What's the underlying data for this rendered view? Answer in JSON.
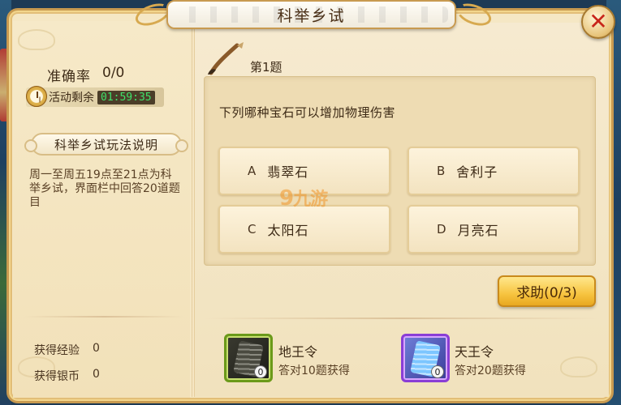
{
  "dialog": {
    "title": "科举乡试",
    "close_label": "✕"
  },
  "left_panel": {
    "accuracy_label": "准确率",
    "accuracy_value": "0/0",
    "timer_label": "活动剩余",
    "timer_value": "01:59:35",
    "rules_title": "科举乡试玩法说明",
    "rules_text": "周一至周五19点至21点为科举乡试，界面栏中回答20道题目",
    "stats": [
      {
        "label": "获得经验",
        "value": "0"
      },
      {
        "label": "获得银币",
        "value": "0"
      }
    ]
  },
  "question": {
    "number_label": "第1题",
    "text": "下列哪种宝石可以增加物理伤害",
    "options": [
      {
        "letter": "A",
        "text": "翡翠石"
      },
      {
        "letter": "B",
        "text": "舍利子"
      },
      {
        "letter": "C",
        "text": "太阳石"
      },
      {
        "letter": "D",
        "text": "月亮石"
      }
    ]
  },
  "help_button_label": "求助(0/3)",
  "watermark": {
    "nine": "9",
    "text": "九游"
  },
  "items": [
    {
      "name": "地王令",
      "desc": "答对10题获得",
      "count": "0",
      "icon": "scroll-dark-icon"
    },
    {
      "name": "天王令",
      "desc": "答对20题获得",
      "count": "0",
      "icon": "scroll-blue-icon"
    }
  ]
}
